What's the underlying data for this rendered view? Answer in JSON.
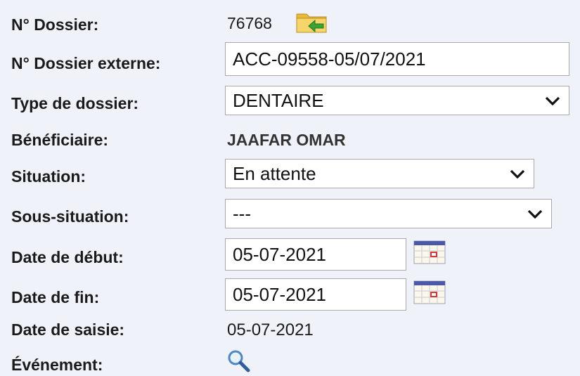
{
  "dossier": {
    "label": "N° Dossier:",
    "value": "76768",
    "icon": "folder-arrow-icon"
  },
  "dossier_externe": {
    "label": "N° Dossier externe:",
    "value": "ACC-09558-05/07/2021"
  },
  "type_dossier": {
    "label": "Type de dossier:",
    "selected": "DENTAIRE"
  },
  "beneficiaire": {
    "label": "Bénéficiaire:",
    "value": "JAAFAR OMAR"
  },
  "situation": {
    "label": "Situation:",
    "selected": "En attente"
  },
  "sous_situation": {
    "label": "Sous-situation:",
    "selected": "---"
  },
  "date_debut": {
    "label": "Date de début:",
    "value": "05-07-2021",
    "icon": "calendar-icon"
  },
  "date_fin": {
    "label": "Date de fin:",
    "value": "05-07-2021",
    "icon": "calendar-icon"
  },
  "date_saisie": {
    "label": "Date de saisie:",
    "value": "05-07-2021"
  },
  "evenement": {
    "label": "Événement:",
    "icon": "magnifier-icon"
  },
  "colors": {
    "background": "#eff3f9",
    "field_border": "#a9a9a9",
    "folder": "#f2c94c",
    "arrow": "#3aa334"
  }
}
